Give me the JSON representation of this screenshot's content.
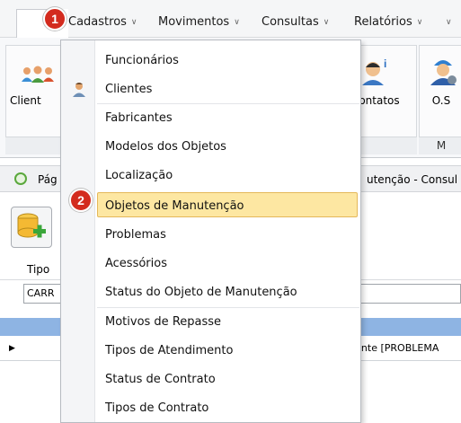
{
  "menubar": {
    "items": [
      {
        "label": "Cadastros"
      },
      {
        "label": "Movimentos"
      },
      {
        "label": "Consultas"
      },
      {
        "label": "Relatórios"
      }
    ]
  },
  "ribbon": {
    "buttons": [
      {
        "label": "Client"
      },
      {
        "label": "ontatos"
      },
      {
        "label": "O.S"
      }
    ],
    "group_labels": [
      "M"
    ]
  },
  "breadcrumb": {
    "left": "Pág",
    "right": "utenção - Consul"
  },
  "filter": {
    "header": "Tipo",
    "value": "CARR"
  },
  "grid": {
    "row_text": "cliente [PROBLEMA"
  },
  "dropdown": {
    "items": [
      {
        "label": "Funcionários"
      },
      {
        "label": "Clientes"
      },
      {
        "label": "Fabricantes"
      },
      {
        "label": "Modelos dos Objetos"
      },
      {
        "label": "Localização"
      },
      {
        "label": "Objetos de Manutenção"
      },
      {
        "label": "Problemas"
      },
      {
        "label": "Acessórios"
      },
      {
        "label": "Status do Objeto de Manutenção"
      },
      {
        "label": "Motivos de Repasse"
      },
      {
        "label": "Tipos de Atendimento"
      },
      {
        "label": "Status de Contrato"
      },
      {
        "label": "Tipos de Contrato"
      }
    ],
    "highlighted_index": 5
  },
  "badges": [
    "1",
    "2"
  ],
  "colors": {
    "badge": "#d32b1e",
    "highlight": "#fde7a2",
    "grid_header": "#8eb4e3"
  },
  "icons": [
    "chevron-down-icon",
    "user-icon",
    "users-icon",
    "contact-icon",
    "worker-icon",
    "database-add-icon",
    "refresh-icon",
    "row-pointer-icon"
  ]
}
